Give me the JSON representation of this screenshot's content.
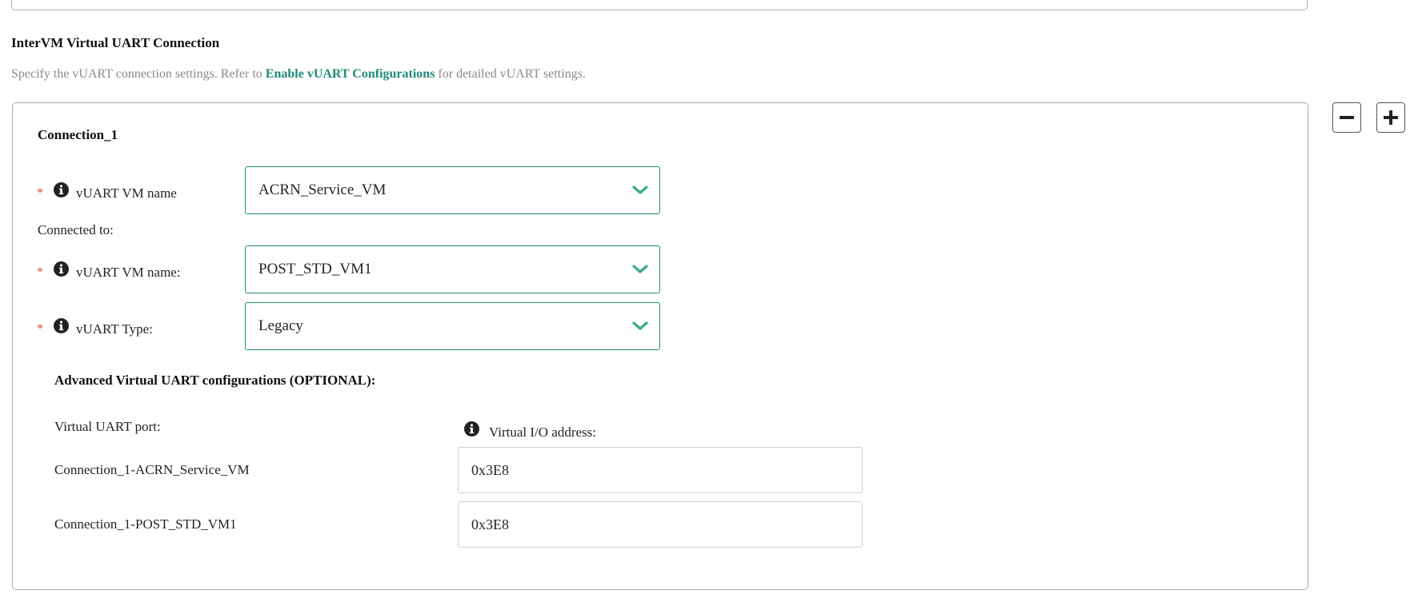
{
  "section": {
    "title": "InterVM Virtual UART Connection",
    "desc_before": "Specify the vUART connection settings. Refer to",
    "desc_link": "Enable vUART Configurations",
    "desc_after": "for detailed vUART settings."
  },
  "buttons": {
    "remove_icon": "minus-icon",
    "add_icon": "plus-icon"
  },
  "connection": {
    "title": "Connection_1",
    "required_mark": "*",
    "vm_name_label": "vUART VM name",
    "vm_name_value": "ACRN_Service_VM",
    "connected_to_label": "Connected to:",
    "target_vm_label": "vUART VM name:",
    "target_vm_value": "POST_STD_VM1",
    "type_label": "vUART Type:",
    "type_value": "Legacy",
    "advanced_title": "Advanced Virtual UART configurations (OPTIONAL):",
    "port_header": "Virtual UART port:",
    "io_header": "Virtual I/O address:",
    "rows": [
      {
        "label": "Connection_1-ACRN_Service_VM",
        "value": "0x3E8"
      },
      {
        "label": "Connection_1-POST_STD_VM1",
        "value": "0x3E8"
      }
    ]
  },
  "colors": {
    "accent": "#1f8b78",
    "required": "#e0473d",
    "muted": "#8a8a8a"
  }
}
